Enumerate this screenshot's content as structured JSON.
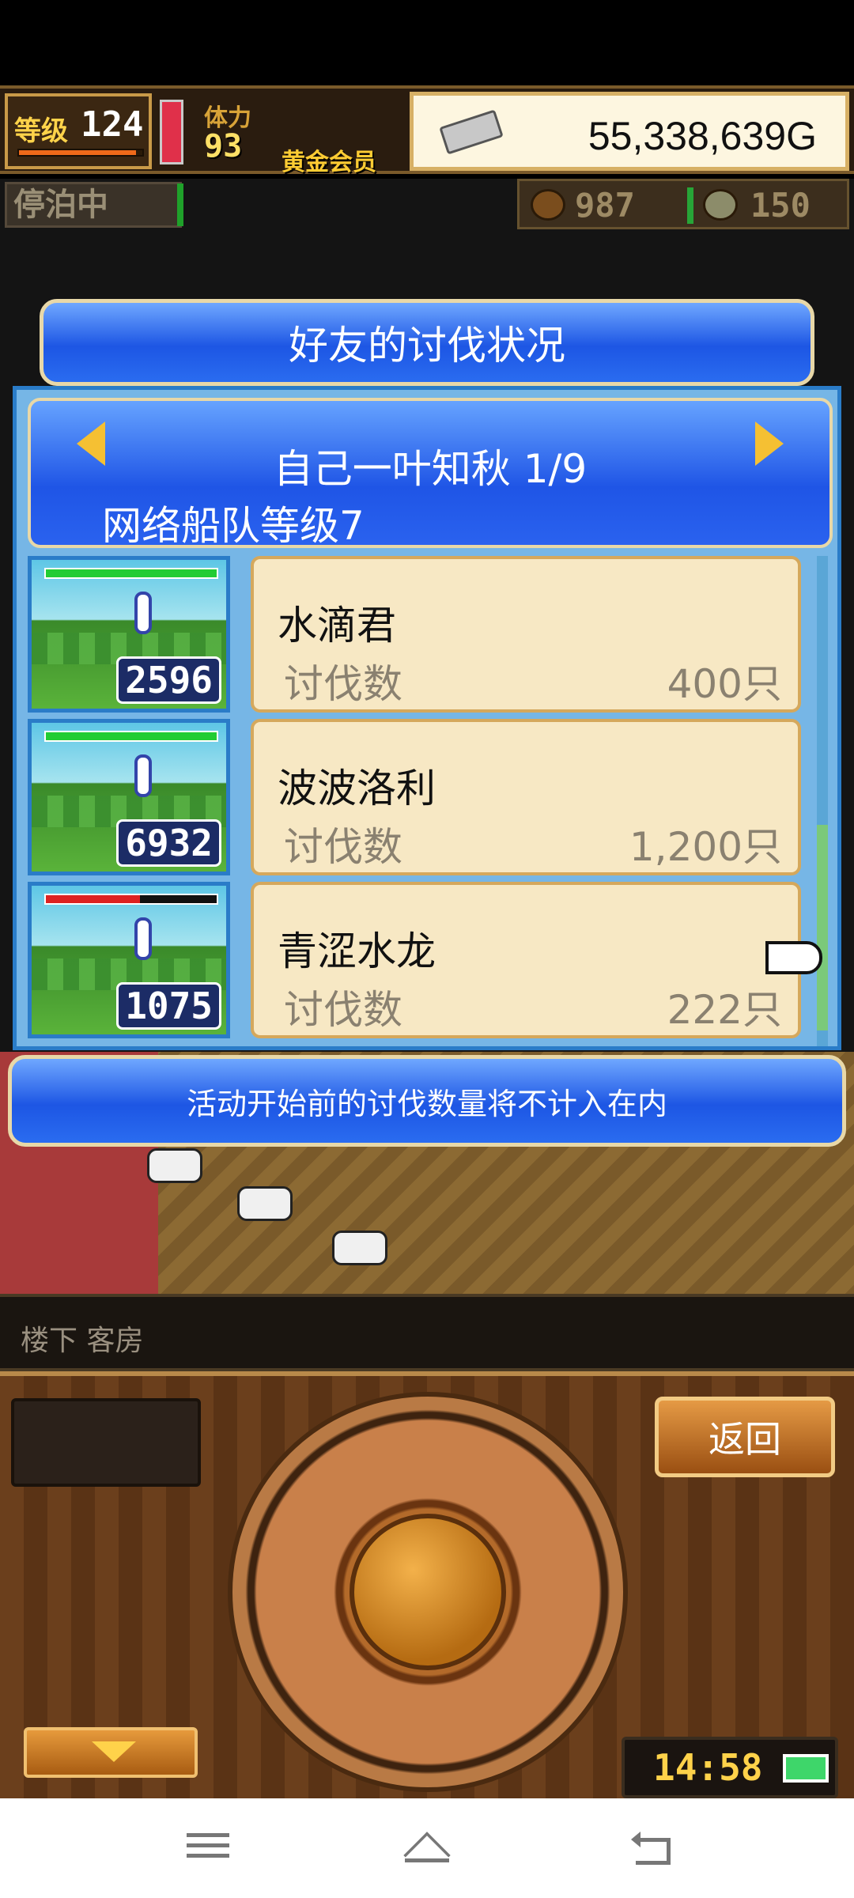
{
  "hud": {
    "level_label": "等级",
    "level_value": "124",
    "level_bar_fraction": 0.95,
    "stamina_label": "体力",
    "stamina_value": "93",
    "membership": "黄金会员",
    "gold_value": "55,338,639G",
    "dock_status": "停泊中",
    "resource_1": "987",
    "resource_2": "150"
  },
  "dialog": {
    "title": "好友的讨伐状况",
    "friend_name": "自己一叶知秋 1/9",
    "fleet_level": "网络船队等级7",
    "notice": "活动开始前的讨伐数量将不计入在内",
    "rows": [
      {
        "badge": "2596",
        "name": "水滴君",
        "kill_label": "讨伐数",
        "kill_value": "400只",
        "hp_fraction": 1.0,
        "hp_color": "#22cc33"
      },
      {
        "badge": "6932",
        "name": "波波洛利",
        "kill_label": "讨伐数",
        "kill_value": "1,200只",
        "hp_fraction": 1.0,
        "hp_color": "#22cc33"
      },
      {
        "badge": "1075",
        "name": "青涩水龙",
        "kill_label": "讨伐数",
        "kill_value": "222只",
        "hp_fraction": 0.55,
        "hp_color": "#dd2222"
      }
    ]
  },
  "bottom": {
    "location": "楼下 客房",
    "back_label": "返回",
    "clock": "14:58"
  }
}
